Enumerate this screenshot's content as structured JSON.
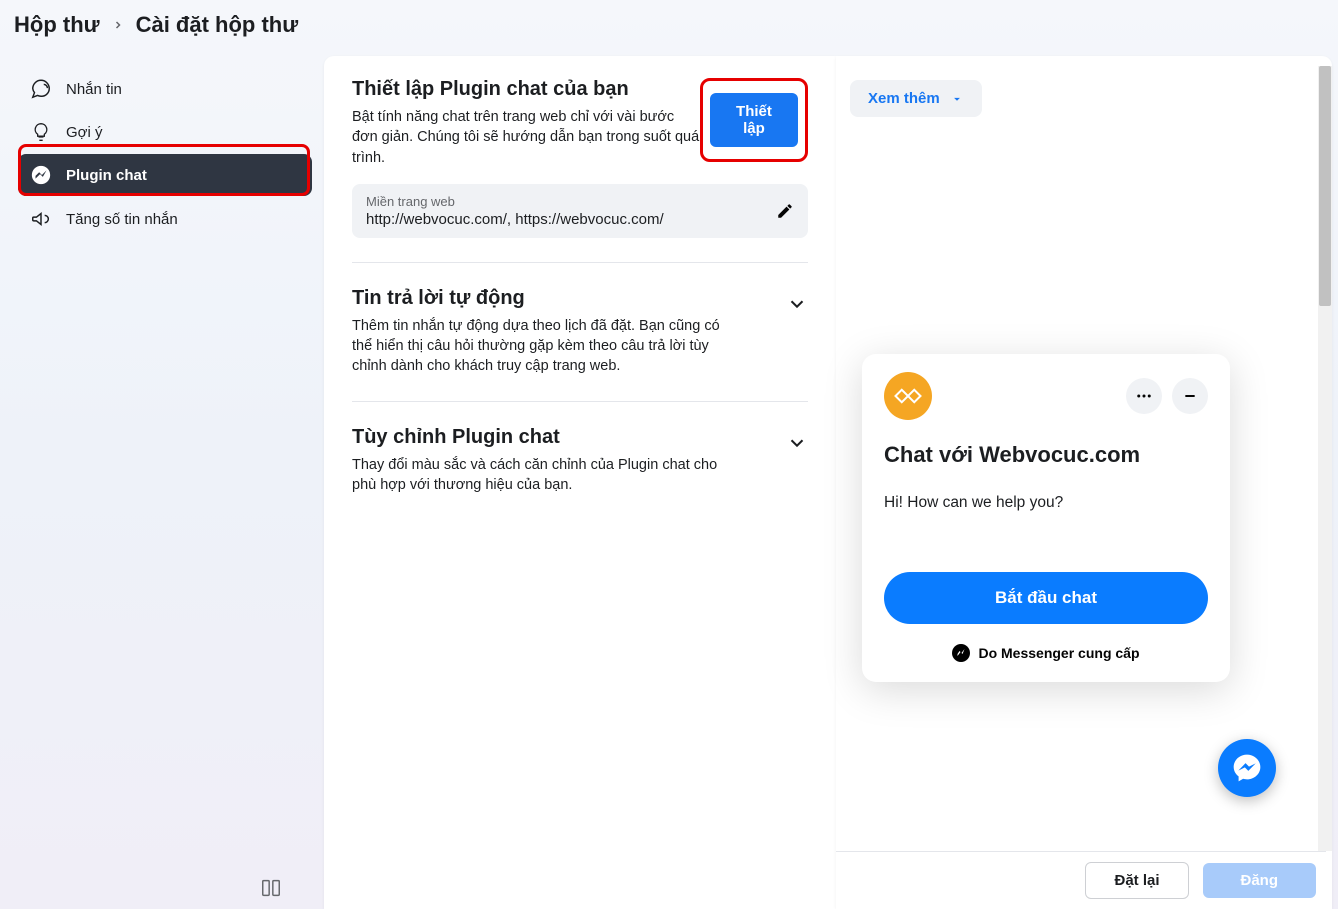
{
  "breadcrumb": {
    "parent": "Hộp thư",
    "current": "Cài đặt hộp thư"
  },
  "sidebar": {
    "items": [
      {
        "label": "Nhắn tin"
      },
      {
        "label": "Gợi ý"
      },
      {
        "label": "Plugin chat"
      },
      {
        "label": "Tăng số tin nhắn"
      }
    ]
  },
  "setup": {
    "title": "Thiết lập Plugin chat của bạn",
    "desc": "Bật tính năng chat trên trang web chỉ với vài bước đơn giản. Chúng tôi sẽ hướng dẫn bạn trong suốt quá trình.",
    "button": "Thiết lập",
    "domain_label": "Miền trang web",
    "domain_value": "http://webvocuc.com/, https://webvocuc.com/"
  },
  "auto_reply": {
    "title": "Tin trả lời tự động",
    "desc": "Thêm tin nhắn tự động dựa theo lịch đã đặt. Bạn cũng có thể hiển thị câu hỏi thường gặp kèm theo câu trả lời tùy chỉnh dành cho khách truy cập trang web."
  },
  "customize": {
    "title": "Tùy chỉnh Plugin chat",
    "desc": "Thay đổi màu sắc và cách căn chỉnh của Plugin chat cho phù hợp với thương hiệu của bạn."
  },
  "preview": {
    "more_label": "Xem thêm",
    "chat_title": "Chat với Webvocuc.com",
    "greeting": "Hi! How can we help you?",
    "start_button": "Bắt đầu chat",
    "footer": "Do Messenger cung cấp"
  },
  "footer": {
    "reset": "Đặt lại",
    "submit": "Đăng"
  }
}
